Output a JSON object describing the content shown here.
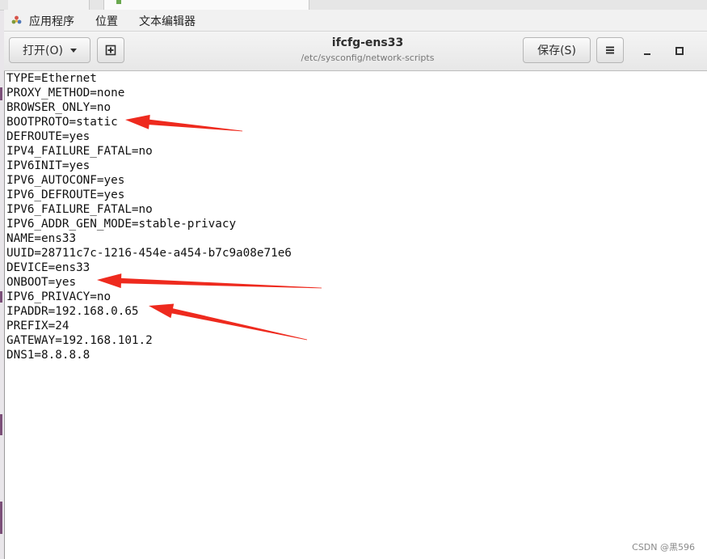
{
  "topbar": {
    "applications": "应用程序",
    "places": "位置",
    "app_name": "文本编辑器"
  },
  "headerbar": {
    "open_label": "打开(O)",
    "title": "ifcfg-ens33",
    "subtitle": "/etc/sysconfig/network-scripts",
    "save_label": "保存(S)"
  },
  "icons": {
    "apps": "applications-icon",
    "new_doc": "new-document-icon",
    "menu": "hamburger-menu-icon",
    "minimize": "minimize-icon",
    "maximize": "maximize-icon",
    "dropdown": "chevron-down-icon"
  },
  "editor": {
    "lines": [
      "TYPE=Ethernet",
      "PROXY_METHOD=none",
      "BROWSER_ONLY=no",
      "BOOTPROTO=static",
      "DEFROUTE=yes",
      "IPV4_FAILURE_FATAL=no",
      "IPV6INIT=yes",
      "IPV6_AUTOCONF=yes",
      "IPV6_DEFROUTE=yes",
      "IPV6_FAILURE_FATAL=no",
      "IPV6_ADDR_GEN_MODE=stable-privacy",
      "NAME=ens33",
      "UUID=28711c7c-1216-454e-a454-b7c9a08e71e6",
      "DEVICE=ens33",
      "ONBOOT=yes",
      "IPV6_PRIVACY=no",
      "IPADDR=192.168.0.65",
      "PREFIX=24",
      "GATEWAY=192.168.101.2",
      "DNS1=8.8.8.8"
    ]
  },
  "annotations": {
    "arrow_color": "#ee2a1e",
    "highlighted_lines": [
      "BOOTPROTO=static",
      "ONBOOT=yes",
      "IPADDR=192.168.0.65"
    ]
  },
  "watermark": "CSDN @黑596",
  "colors": {
    "editor_bg": "#ffffff",
    "headerbar_bg": "#ececec",
    "desktop_accent": "#7b4f78"
  }
}
